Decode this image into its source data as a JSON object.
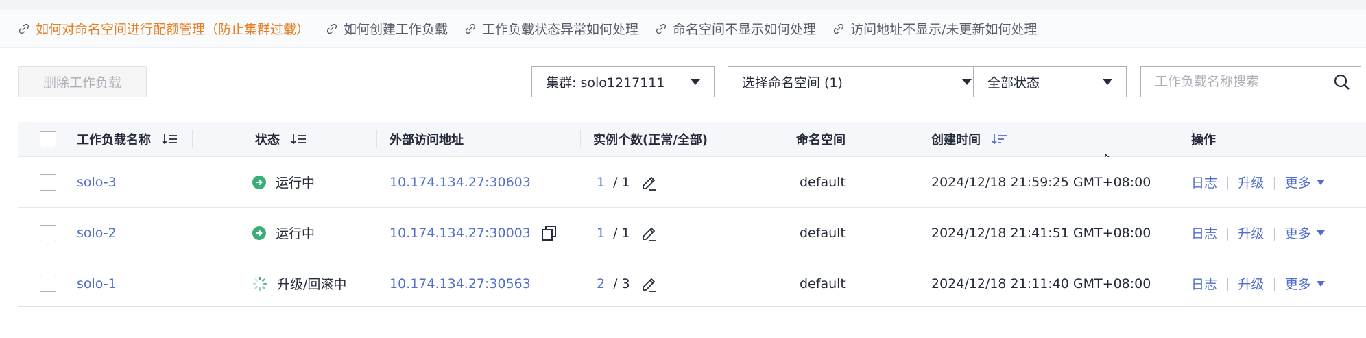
{
  "help_links": [
    {
      "label": "如何对命名空间进行配额管理（防止集群过载）"
    },
    {
      "label": "如何创建工作负载"
    },
    {
      "label": "工作负载状态异常如何处理"
    },
    {
      "label": "命名空间不显示如何处理"
    },
    {
      "label": "访问地址不显示/未更新如何处理"
    }
  ],
  "toolbar": {
    "delete_label": "删除工作负载",
    "cluster_select": "集群:  solo1217111",
    "namespace_select": "选择命名空间 (1)",
    "status_select": "全部状态",
    "search_placeholder": "工作负载名称搜索"
  },
  "table": {
    "headers": [
      "工作负载名称",
      "状态",
      "外部访问地址",
      "实例个数(正常/全部)",
      "命名空间",
      "创建时间",
      "操作"
    ],
    "rows": [
      {
        "name": "solo-3",
        "status": "运行中",
        "address": "10.174.134.27:30603",
        "running": "1",
        "total": "/ 1",
        "namespace": "default",
        "created": "2024/12/18 21:59:25 GMT+08:00",
        "op_log": "日志",
        "op_upgrade": "升级",
        "op_more": "更多"
      },
      {
        "name": "solo-2",
        "status": "运行中",
        "address": "10.174.134.27:30003",
        "running": "1",
        "total": "/ 1",
        "namespace": "default",
        "created": "2024/12/18 21:41:51 GMT+08:00",
        "op_log": "日志",
        "op_upgrade": "升级",
        "op_more": "更多"
      },
      {
        "name": "solo-1",
        "status": "升级/回滚中",
        "address": "10.174.134.27:30563",
        "running": "2",
        "total": "/ 3",
        "namespace": "default",
        "created": "2024/12/18 21:11:40 GMT+08:00",
        "op_log": "日志",
        "op_upgrade": "升级",
        "op_more": "更多"
      }
    ]
  },
  "icons": {
    "link": "link-icon",
    "running": "running-status-icon",
    "updating": "loading-spinner-icon",
    "edit": "edit-pencil-icon",
    "copy": "copy-icon",
    "search": "search-icon",
    "sort": "sort-icon"
  },
  "colors": {
    "accent_link": "#526ecc",
    "warning_link": "#e67e22",
    "running_green": "#3aad78"
  }
}
